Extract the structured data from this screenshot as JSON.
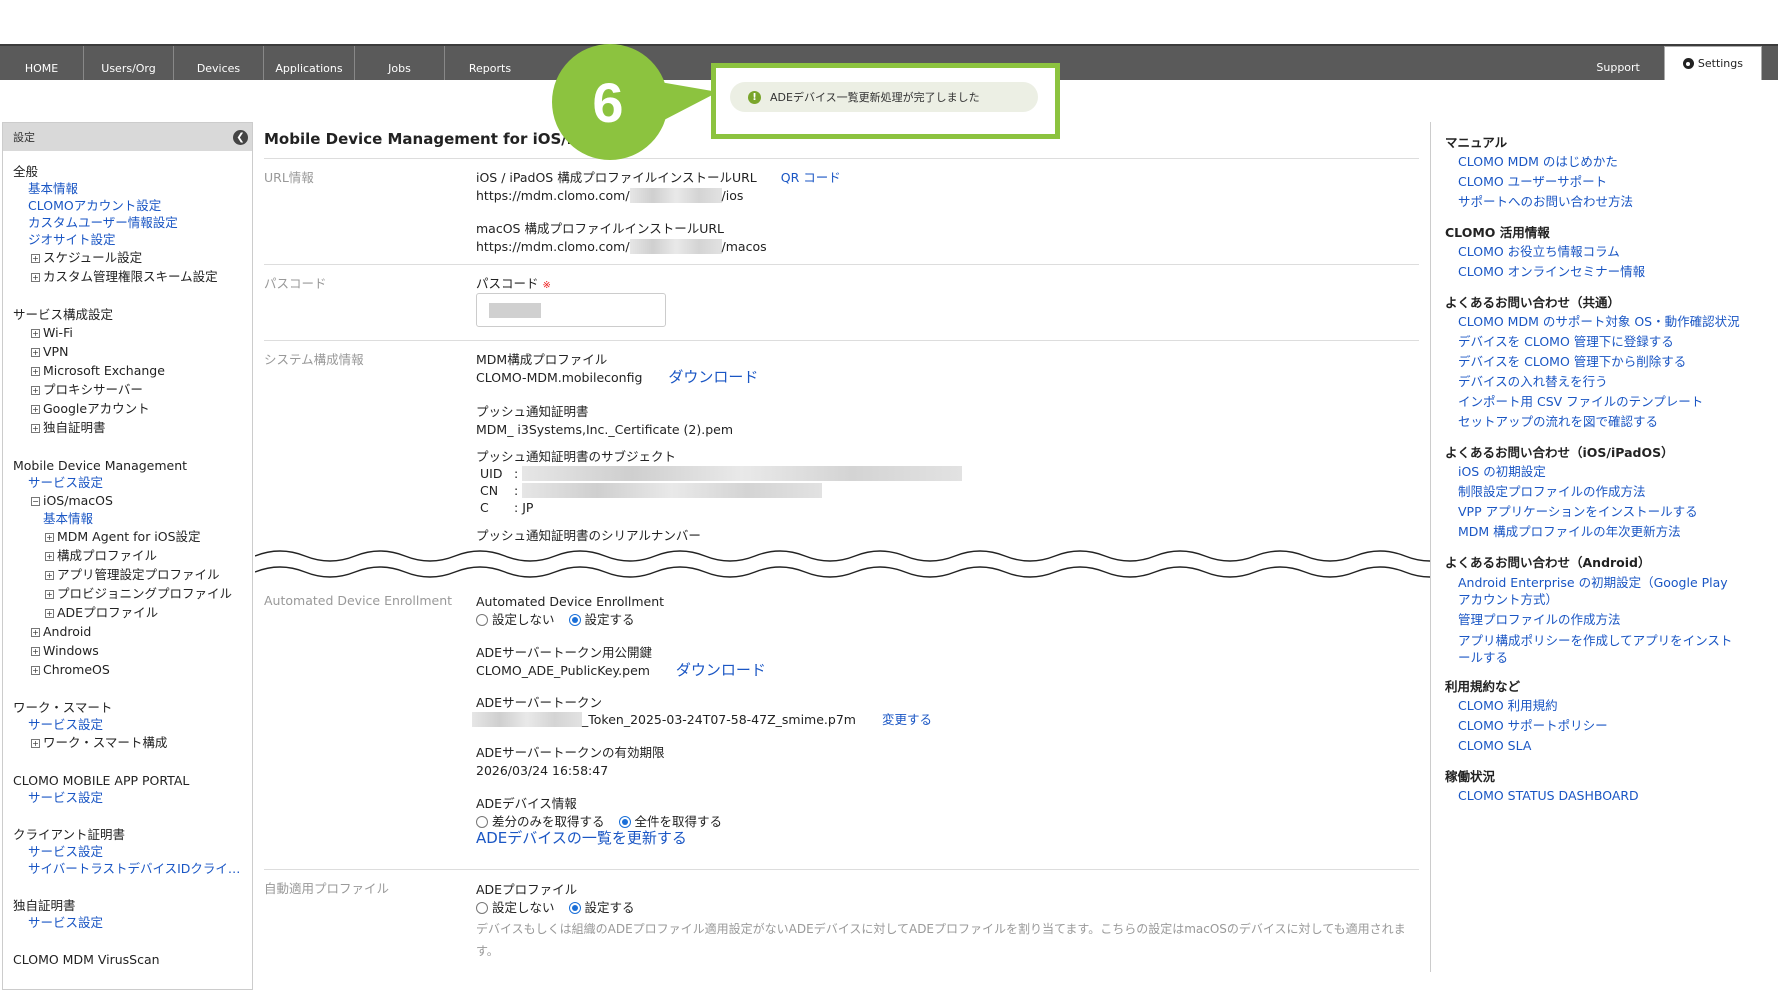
{
  "nav": {
    "items": [
      "HOME",
      "Users/Org",
      "Devices",
      "Applications",
      "Jobs",
      "Reports"
    ],
    "support": "Support",
    "settings": "Settings"
  },
  "callout": {
    "step": "6",
    "toast": "ADEデバイス一覧更新処理が完了しました"
  },
  "sidebar": {
    "header": "設定",
    "general": {
      "title": "全般",
      "links": [
        "基本情報",
        "CLOMOアカウント設定",
        "カスタムユーザー情報設定",
        "ジオサイト設定"
      ],
      "tree": [
        "スケジュール設定",
        "カスタム管理権限スキーム設定"
      ]
    },
    "service": {
      "title": "サービス構成設定",
      "tree": [
        "Wi-Fi",
        "VPN",
        "Microsoft Exchange",
        "プロキシサーバー",
        "Googleアカウント",
        "独自証明書"
      ]
    },
    "mdm": {
      "title": "Mobile Device Management",
      "service_link": "サービス設定",
      "ios": "iOS/macOS",
      "basic": "基本情報",
      "ios_tree": [
        "MDM Agent for iOS設定",
        "構成プロファイル",
        "アプリ管理設定プロファイル",
        "プロビジョニングプロファイル",
        "ADEプロファイル"
      ],
      "other_tree": [
        "Android",
        "Windows",
        "ChromeOS"
      ]
    },
    "work": {
      "title": "ワーク・スマート",
      "link": "サービス設定",
      "tree": "ワーク・スマート構成"
    },
    "portal": {
      "title": "CLOMO MOBILE APP PORTAL",
      "link": "サービス設定"
    },
    "client_cert": {
      "title": "クライアント証明書",
      "links": [
        "サービス設定",
        "サイバートラストデバイスIDクライ…"
      ]
    },
    "own_cert": {
      "title": "独自証明書",
      "link": "サービス設定"
    },
    "virus": {
      "title": "CLOMO MDM VirusScan"
    }
  },
  "main": {
    "title": "Mobile Device Management for iOS/m",
    "url_section": {
      "label": "URL情報",
      "ios_label": "iOS / iPadOS 構成プロファイルインストールURL",
      "qr": "QR コード",
      "ios_prefix": "https://mdm.clomo.com/",
      "ios_suffix": "/ios",
      "mac_label": "macOS 構成プロファイルインストールURL",
      "mac_prefix": "https://mdm.clomo.com/",
      "mac_suffix": "/macos"
    },
    "passcode": {
      "label": "パスコード",
      "field_label": "パスコード",
      "required": "※"
    },
    "system": {
      "label": "システム構成情報",
      "mdm_profile_label": "MDM構成プロファイル",
      "mdm_profile_file": "CLOMO-MDM.mobileconfig",
      "download": "ダウンロード",
      "push_cert_label": "プッシュ通知証明書",
      "push_cert_file": "MDM_ i3Systems,Inc._Certificate (2).pem",
      "subject_label": "プッシュ通知証明書のサブジェクト",
      "uid": "UID",
      "cn": "CN",
      "c": "C",
      "c_value": "JP",
      "serial_label": "プッシュ通知証明書のシリアルナンバー"
    },
    "ade": {
      "label": "Automated Device Enrollment",
      "field_label": "Automated Device Enrollment",
      "opt_off": "設定しない",
      "opt_on": "設定する",
      "pubkey_label": "ADEサーバートークン用公開鍵",
      "pubkey_file": "CLOMO_ADE_PublicKey.pem",
      "download": "ダウンロード",
      "token_label": "ADEサーバートークン",
      "token_file": "_Token_2025-03-24T07-58-47Z_smime.p7m",
      "change": "変更する",
      "expiry_label": "ADEサーバートークンの有効期限",
      "expiry_value": "2026/03/24 16:58:47",
      "device_info_label": "ADEデバイス情報",
      "opt_diff": "差分のみを取得する",
      "opt_all": "全件を取得する",
      "update_link": "ADEデバイスの一覧を更新する"
    },
    "auto_profile": {
      "label": "自動適用プロファイル",
      "field_label": "ADEプロファイル",
      "opt_off": "設定しない",
      "opt_on": "設定する",
      "note": "デバイスもしくは組織のADEプロファイル適用設定がないADEデバイスに対してADEプロファイルを割り当てます。こちらの設定はmacOSのデバイスに対しても適用されます。"
    }
  },
  "right_panel": {
    "manual": {
      "title": "マニュアル",
      "links": [
        "CLOMO MDM のはじめかた",
        "CLOMO ユーザーサポート",
        "サポートへのお問い合わせ方法"
      ]
    },
    "tips": {
      "title": "CLOMO 活用情報",
      "links": [
        "CLOMO お役立ち情報コラム",
        "CLOMO オンラインセミナー情報"
      ]
    },
    "faq_common": {
      "title": "よくあるお問い合わせ（共通）",
      "links": [
        "CLOMO MDM のサポート対象 OS・動作確認状況",
        "デバイスを CLOMO 管理下に登録する",
        "デバイスを CLOMO 管理下から削除する",
        "デバイスの入れ替えを行う",
        "インポート用 CSV ファイルのテンプレート",
        "セットアップの流れを図で確認する"
      ]
    },
    "faq_ios": {
      "title": "よくあるお問い合わせ（iOS/iPadOS）",
      "links": [
        "iOS の初期設定",
        "制限設定プロファイルの作成方法",
        "VPP アプリケーションをインストールする",
        "MDM 構成プロファイルの年次更新方法"
      ]
    },
    "faq_android": {
      "title": "よくあるお問い合わせ（Android）",
      "links": [
        "Android Enterprise の初期設定（Google Play アカウント方式）",
        "管理プロファイルの作成方法",
        "アプリ構成ポリシーを作成してアプリをインストールする"
      ]
    },
    "terms": {
      "title": "利用規約など",
      "links": [
        "CLOMO 利用規約",
        "CLOMO サポートポリシー",
        "CLOMO SLA"
      ]
    },
    "status": {
      "title": "稼働状況",
      "links": [
        "CLOMO STATUS DASHBOARD"
      ]
    }
  },
  "colors": {
    "nav_bg": "#5a5a5a",
    "link": "#1a56c4",
    "callout_border": "#8cc33f",
    "badge": "#8cc33f",
    "radio_on": "#1a6fd8"
  }
}
